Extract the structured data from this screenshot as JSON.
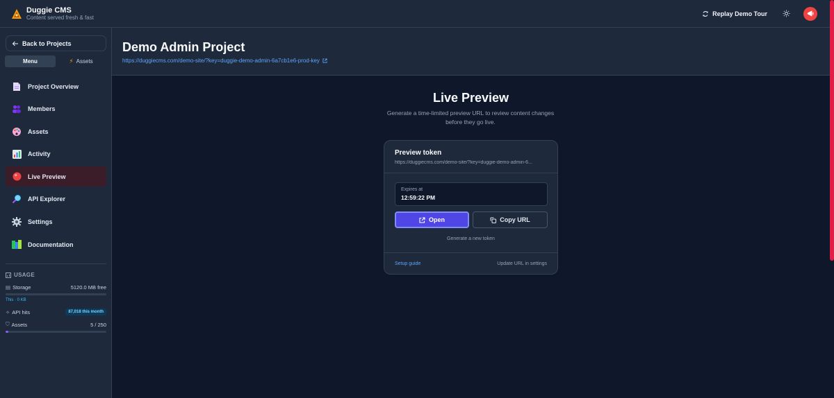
{
  "app": {
    "name": "Duggie CMS",
    "tagline": "Content served fresh & fast",
    "replay_label": "Replay Demo Tour"
  },
  "sidebar": {
    "back_label": "Back to Projects",
    "tabs": [
      {
        "label": "Menu",
        "active": true
      },
      {
        "label": "Assets",
        "active": false
      }
    ],
    "items": [
      {
        "label": "Project Overview",
        "icon": "document-icon"
      },
      {
        "label": "Members",
        "icon": "users-icon"
      },
      {
        "label": "Assets",
        "icon": "palette-icon"
      },
      {
        "label": "Activity",
        "icon": "bar-chart-icon"
      },
      {
        "label": "Live Preview",
        "icon": "red-circle-icon",
        "active": true
      },
      {
        "label": "API Explorer",
        "icon": "magnifier-icon"
      },
      {
        "label": "Settings",
        "icon": "gear-icon"
      },
      {
        "label": "Documentation",
        "icon": "books-icon"
      }
    ]
  },
  "usage": {
    "title": "USAGE",
    "storage_label": "Storage",
    "storage_value": "5120.0 MB free",
    "storage_sub": "This · 0 KB",
    "api_label": "API hits",
    "api_badge": "87,018 this month",
    "assets_label": "Assets",
    "assets_value": "5 / 250",
    "assets_fraction": 0.02
  },
  "header": {
    "title": "Demo Admin Project",
    "url": "https://duggiecms.com/demo-site/?key=duggie-demo-admin-6a7cb1e6-prod-key"
  },
  "preview": {
    "title": "Live Preview",
    "description": "Generate a time-limited preview URL to review content changes before they go live.",
    "card_title": "Preview token",
    "card_url": "https://duggiecms.com/demo-site/?key=duggie-demo-admin-6...",
    "expires_label": "Expires at",
    "expires_value": "12:59:22 PM",
    "open_label": "Open",
    "copy_label": "Copy URL",
    "generate_label": "Generate a new token",
    "setup_label": "Setup guide",
    "update_label": "Update URL in settings"
  },
  "colors": {
    "accent": "#4f46e5",
    "link": "#60a5fa",
    "danger": "#ef4444",
    "background": "#0f172a",
    "panel": "#1e293b"
  }
}
